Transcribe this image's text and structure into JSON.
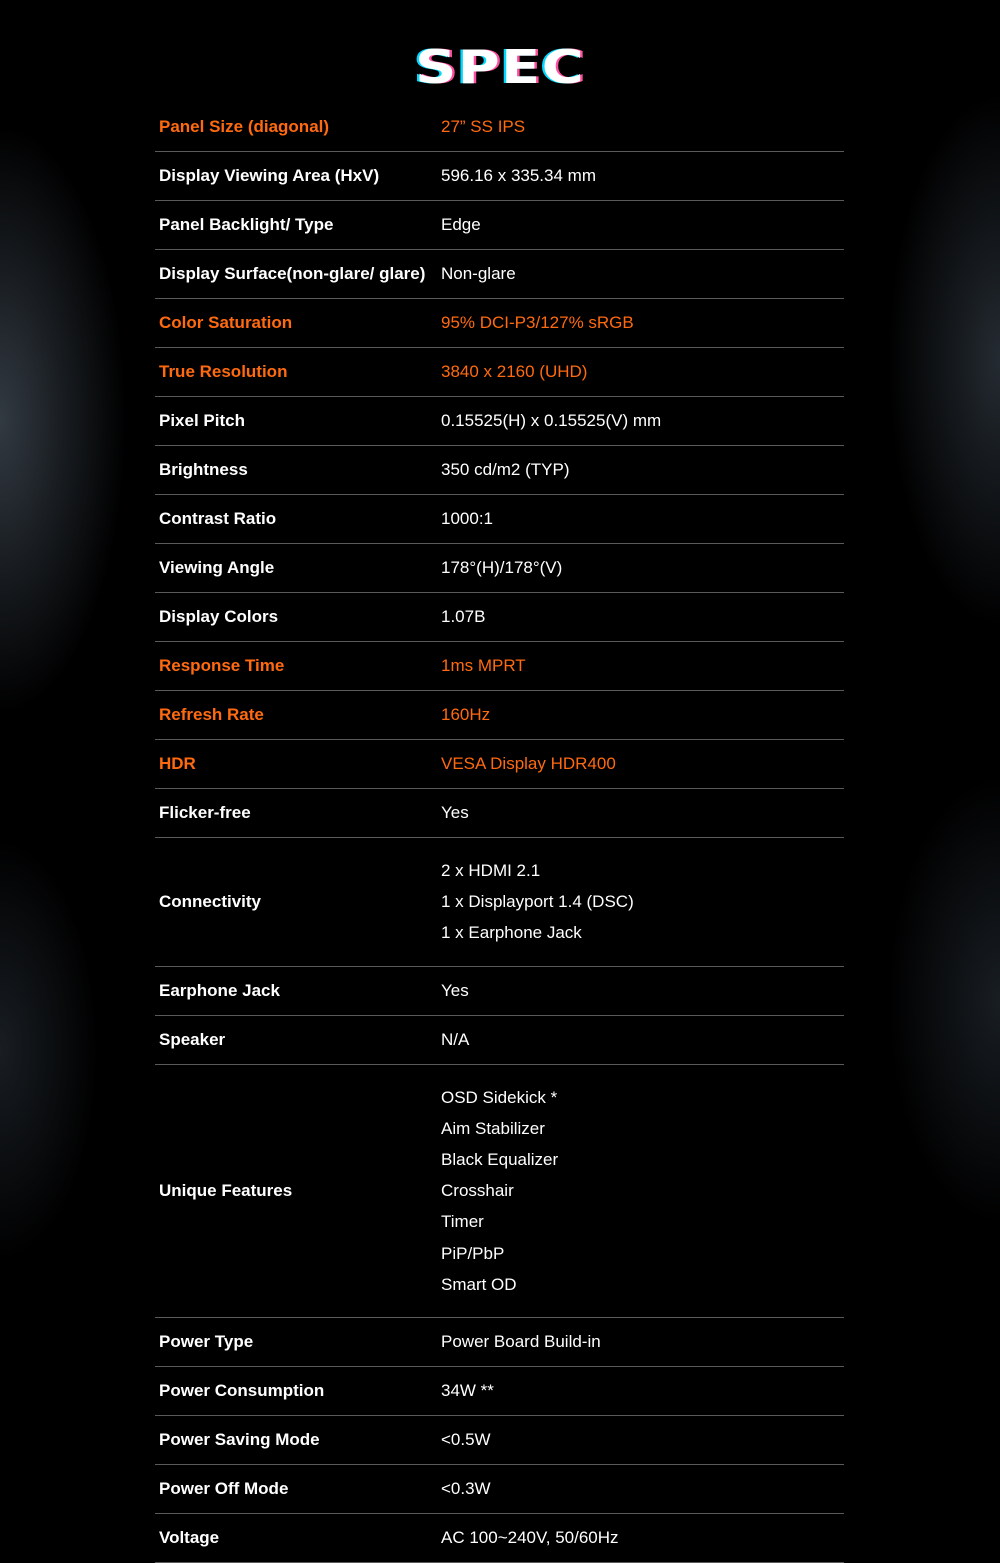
{
  "page": {
    "title": "SPEC"
  },
  "colors": {
    "highlight": "#ff6a10",
    "text": "#ffffff",
    "divider": "#5a5a5a",
    "background": "#000000"
  },
  "specs": [
    {
      "label": "Panel Size (diagonal)",
      "values": [
        "27” SS IPS"
      ],
      "highlight": true
    },
    {
      "label": "Display Viewing Area (HxV)",
      "values": [
        "596.16 x 335.34 mm"
      ],
      "highlight": false
    },
    {
      "label": "Panel Backlight/ Type",
      "values": [
        "Edge"
      ],
      "highlight": false
    },
    {
      "label": "Display Surface(non-glare/ glare)",
      "values": [
        "Non-glare"
      ],
      "highlight": false
    },
    {
      "label": "Color Saturation",
      "values": [
        "95% DCI-P3/127% sRGB"
      ],
      "highlight": true
    },
    {
      "label": "True Resolution",
      "values": [
        "3840 x 2160 (UHD)"
      ],
      "highlight": true
    },
    {
      "label": "Pixel Pitch",
      "values": [
        "0.15525(H) x 0.15525(V) mm"
      ],
      "highlight": false
    },
    {
      "label": "Brightness",
      "values": [
        "350 cd/m2 (TYP)"
      ],
      "highlight": false
    },
    {
      "label": "Contrast Ratio",
      "values": [
        "1000:1"
      ],
      "highlight": false
    },
    {
      "label": "Viewing Angle",
      "values": [
        "178°(H)/178°(V)"
      ],
      "highlight": false
    },
    {
      "label": "Display Colors",
      "values": [
        "1.07B"
      ],
      "highlight": false
    },
    {
      "label": "Response Time",
      "values": [
        "1ms MPRT"
      ],
      "highlight": true
    },
    {
      "label": "Refresh Rate",
      "values": [
        "160Hz"
      ],
      "highlight": true
    },
    {
      "label": "HDR",
      "values": [
        "VESA Display HDR400"
      ],
      "highlight": true
    },
    {
      "label": "Flicker-free",
      "values": [
        "Yes"
      ],
      "highlight": false
    },
    {
      "label": "Connectivity",
      "values": [
        "2 x HDMI 2.1",
        "1 x Displayport 1.4 (DSC)",
        "1 x Earphone Jack"
      ],
      "highlight": false
    },
    {
      "label": "Earphone Jack",
      "values": [
        "Yes"
      ],
      "highlight": false
    },
    {
      "label": "Speaker",
      "values": [
        "N/A"
      ],
      "highlight": false
    },
    {
      "label": "Unique Features",
      "values": [
        "OSD Sidekick *",
        "Aim Stabilizer",
        "Black Equalizer",
        "Crosshair",
        "Timer",
        "PiP/PbP",
        "Smart OD"
      ],
      "highlight": false
    },
    {
      "label": "Power Type",
      "values": [
        "Power Board Build-in"
      ],
      "highlight": false
    },
    {
      "label": "Power Consumption",
      "values": [
        "34W **"
      ],
      "highlight": false
    },
    {
      "label": "Power Saving Mode",
      "values": [
        "<0.5W"
      ],
      "highlight": false
    },
    {
      "label": "Power Off Mode",
      "values": [
        "<0.3W"
      ],
      "highlight": false
    },
    {
      "label": "Voltage",
      "values": [
        "AC 100~240V, 50/60Hz"
      ],
      "highlight": false
    }
  ]
}
